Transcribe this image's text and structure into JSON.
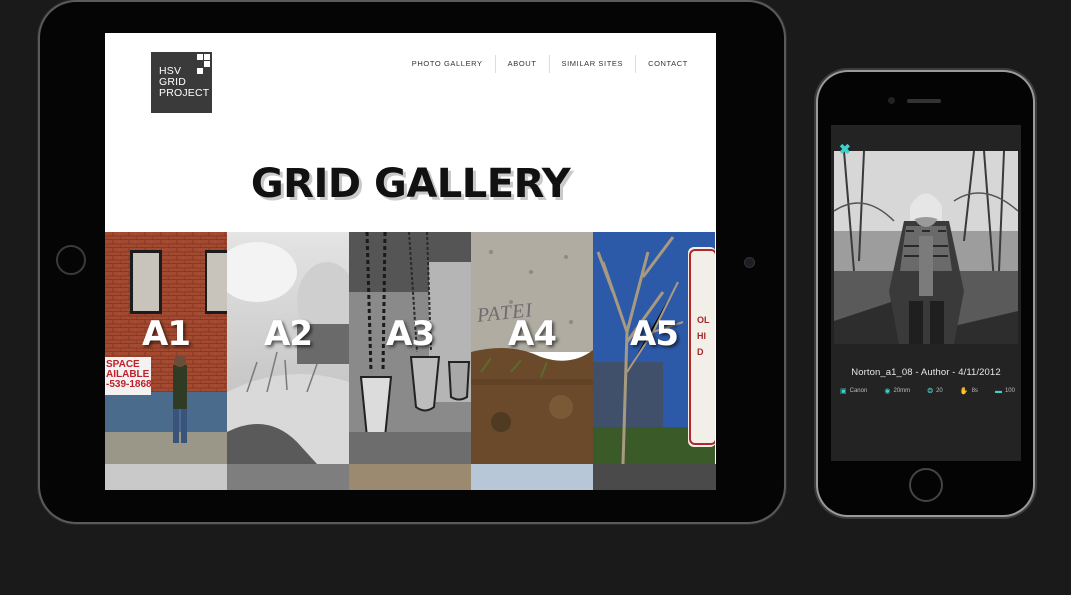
{
  "site": {
    "logo_lines": [
      "HSV",
      "GRID",
      "PROJECT"
    ],
    "nav": [
      "PHOTO GALLERY",
      "ABOUT",
      "SIMILAR SITES",
      "CONTACT"
    ],
    "headline": "GRID GALLERY",
    "tiles": [
      {
        "label": "A1",
        "accent": "#a5492f"
      },
      {
        "label": "A2",
        "accent": "#d8d8d8"
      },
      {
        "label": "A3",
        "accent": "#6b6b6b"
      },
      {
        "label": "A4",
        "accent": "#8d8576"
      },
      {
        "label": "A5",
        "accent": "#2f4f87"
      }
    ],
    "tile_overlays": {
      "a1_sign": "SPACE\nAILABLE\n-539-1868",
      "a4_graffiti": "PATEI",
      "a5_sign": "OL\nHI\nD"
    }
  },
  "lightbox": {
    "close_icon": "close-icon",
    "caption": "Norton_a1_08 - Author - 4/11/2012",
    "meta": [
      {
        "icon": "camera-icon",
        "glyph": "▣",
        "value": "Canon"
      },
      {
        "icon": "eye-icon",
        "glyph": "◉",
        "value": "20mm"
      },
      {
        "icon": "aperture-icon",
        "glyph": "❂",
        "value": "20"
      },
      {
        "icon": "hand-icon",
        "glyph": "✋",
        "value": "8s"
      },
      {
        "icon": "iso-icon",
        "glyph": "▬",
        "value": "100"
      }
    ]
  },
  "colors": {
    "accent": "#3fd0cc",
    "background": "#1a1a1a"
  }
}
